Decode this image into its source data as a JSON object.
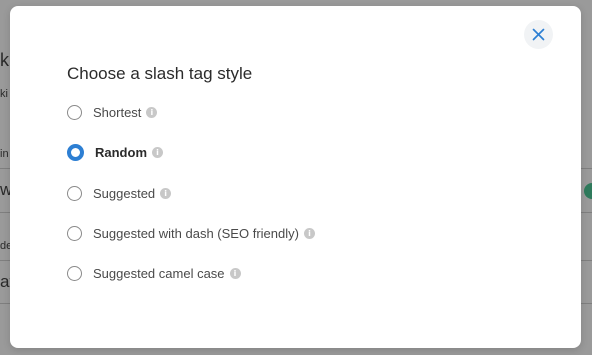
{
  "modal": {
    "title": "Choose a slash tag style",
    "close_icon": "close-icon",
    "accent_color": "#2d7fd3",
    "options": [
      {
        "label": "Shortest",
        "checked": false,
        "info_icon": "info-icon"
      },
      {
        "label": "Random",
        "checked": true,
        "info_icon": "info-icon"
      },
      {
        "label": "Suggested",
        "checked": false,
        "info_icon": "info-icon"
      },
      {
        "label": "Suggested with dash (SEO friendly)",
        "checked": false,
        "info_icon": "info-icon"
      },
      {
        "label": "Suggested camel case",
        "checked": false,
        "info_icon": "info-icon"
      }
    ]
  },
  "background": {
    "fragments": [
      "k",
      "ki",
      "in",
      "w",
      "de",
      "at"
    ]
  }
}
